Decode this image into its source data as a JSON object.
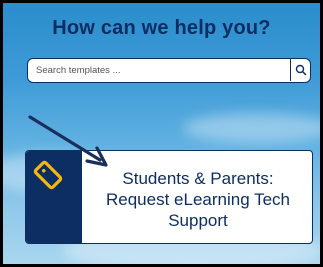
{
  "header": {
    "title": "How can we help you?"
  },
  "search": {
    "placeholder": "Search templates ...",
    "icon": "search-icon"
  },
  "card": {
    "line1": "Students & Parents:",
    "line2": "Request eLearning Tech",
    "line3": "Support",
    "icon": "tag-icon",
    "icon_color": "#f5b80f"
  },
  "colors": {
    "navy": "#0d2e63",
    "accent": "#f5b80f"
  }
}
